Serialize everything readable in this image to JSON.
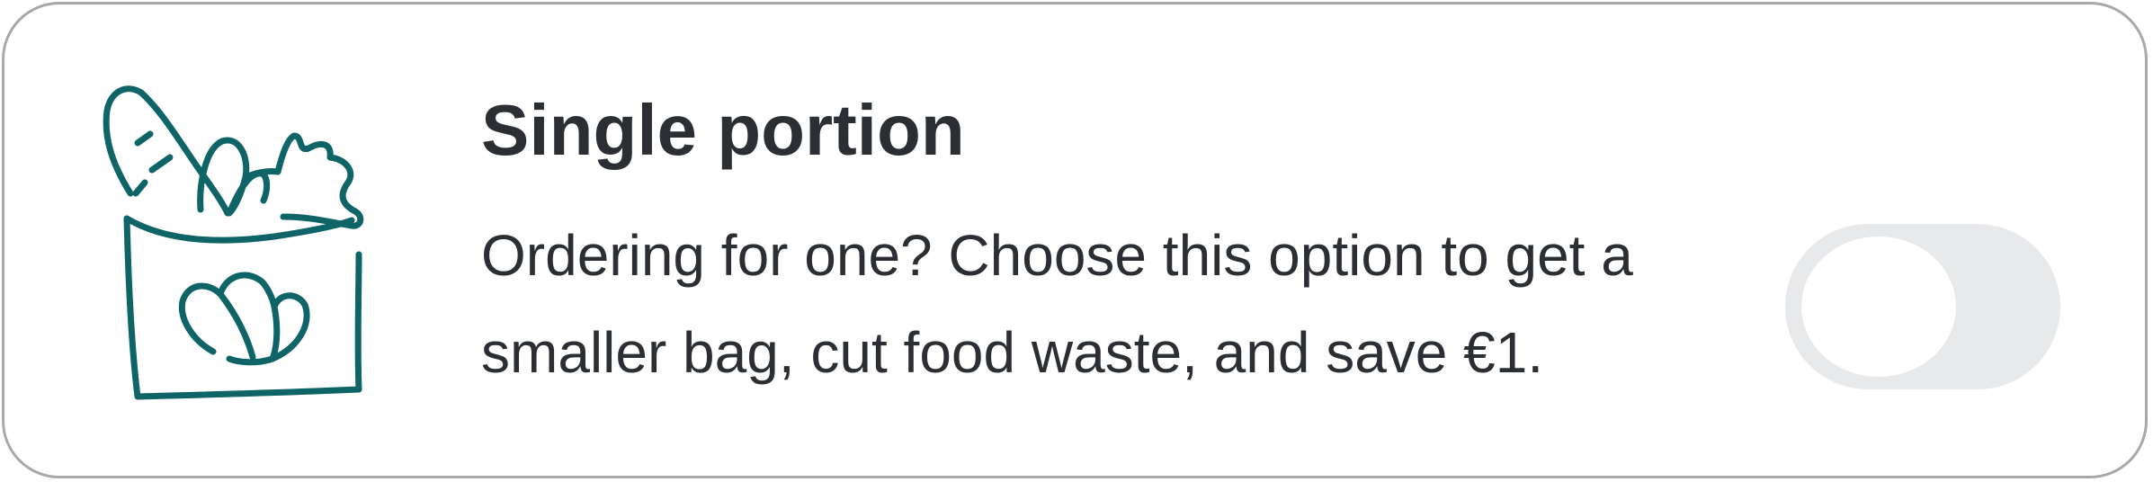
{
  "option": {
    "icon": "grocery-bag-icon",
    "title": "Single portion",
    "description": "Ordering for one? Choose this option to get a smaller bag, cut food waste, and save €1.",
    "toggle": {
      "state": "off",
      "track_color": "#e8e9eb",
      "knob_color": "#ffffff"
    }
  },
  "colors": {
    "icon_stroke": "#0e6466",
    "text": "#2b2f33",
    "border": "#a8a8a8"
  }
}
